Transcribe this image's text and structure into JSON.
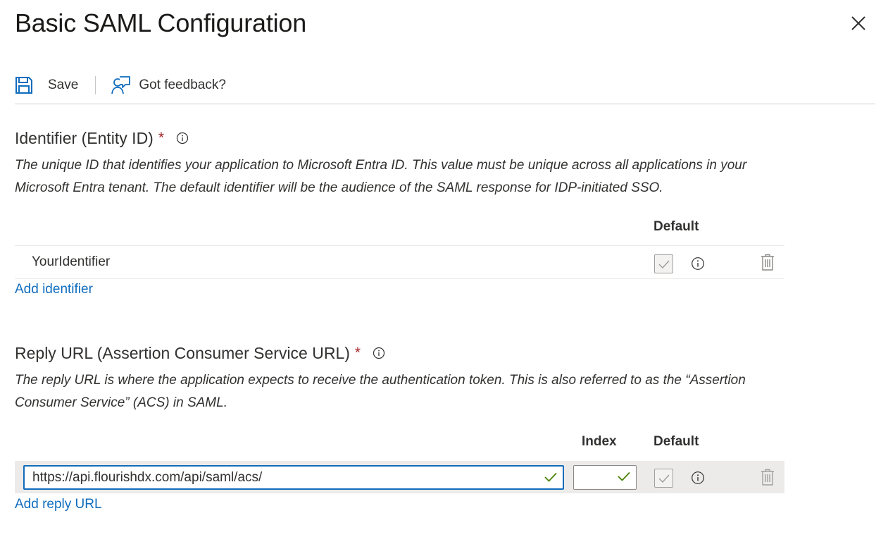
{
  "header": {
    "title": "Basic SAML Configuration",
    "close_icon": "close-icon"
  },
  "toolbar": {
    "save_label": "Save",
    "save_icon": "save-icon",
    "feedback_label": "Got feedback?",
    "feedback_icon": "feedback-icon"
  },
  "identifier_section": {
    "title": "Identifier (Entity ID)",
    "required_mark": "*",
    "description": "The unique ID that identifies your application to Microsoft Entra ID. This value must be unique across all applications in your Microsoft Entra tenant. The default identifier will be the audience of the SAML response for IDP-initiated SSO.",
    "column_default": "Default",
    "rows": [
      {
        "value": "YourIdentifier",
        "default_checked": true
      }
    ],
    "add_link": "Add identifier"
  },
  "reply_section": {
    "title": "Reply URL (Assertion Consumer Service URL)",
    "required_mark": "*",
    "description": "The reply URL is where the application expects to receive the authentication token. This is also referred to as the “Assertion Consumer Service” (ACS) in SAML.",
    "column_index": "Index",
    "column_default": "Default",
    "rows": [
      {
        "url": "https://api.flourishdx.com/api/saml/acs/",
        "index": "",
        "default_checked": true
      }
    ],
    "add_link": "Add reply URL"
  },
  "colors": {
    "accent": "#0f6cbd",
    "required": "#a4262c",
    "valid_check": "#498205",
    "row_shade": "#edebe9"
  }
}
